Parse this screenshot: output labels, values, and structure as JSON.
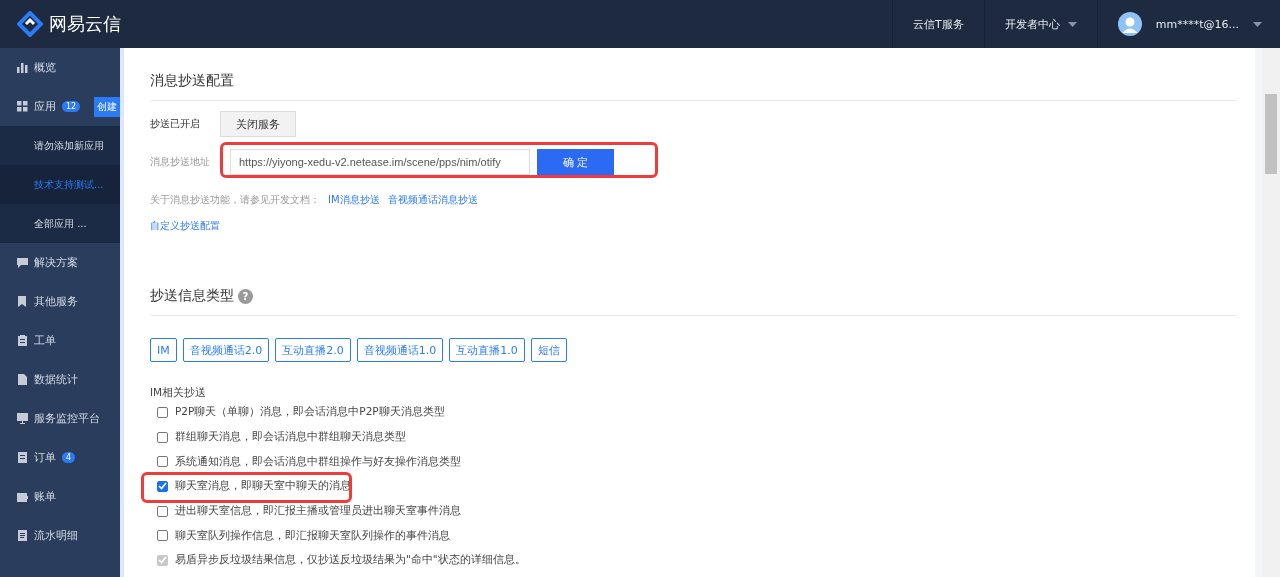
{
  "header": {
    "brand": "网易云信",
    "links": [
      {
        "label": "云信T服务",
        "dropdown": false
      },
      {
        "label": "开发者中心",
        "dropdown": true
      }
    ],
    "user": {
      "name": "mm****t@16..."
    }
  },
  "sidebar": {
    "items": [
      {
        "kind": "item",
        "label": "概览"
      },
      {
        "kind": "item",
        "label": "应用",
        "badge": "12",
        "action": "创建"
      },
      {
        "kind": "sub",
        "label": "请勿添加新应用",
        "selected": false
      },
      {
        "kind": "sub",
        "label": "技术支持测试...",
        "selected": true
      },
      {
        "kind": "sub",
        "label": "全部应用 ...",
        "selected": false
      },
      {
        "kind": "item",
        "label": "解决方案"
      },
      {
        "kind": "item",
        "label": "其他服务"
      },
      {
        "kind": "item",
        "label": "工单"
      },
      {
        "kind": "item",
        "label": "数据统计"
      },
      {
        "kind": "item",
        "label": "服务监控平台"
      },
      {
        "kind": "item",
        "label": "订单",
        "badge": "4"
      },
      {
        "kind": "item",
        "label": "账单"
      },
      {
        "kind": "item",
        "label": "流水明细"
      }
    ]
  },
  "config": {
    "title": "消息抄送配置",
    "status_label": "抄送已开启",
    "close_button": "关闭服务",
    "address_label": "消息抄送地址",
    "address_value": "https://yiyong-xedu-v2.netease.im/scene/pps/nim/otify",
    "confirm_button": "确 定",
    "highlighted": true,
    "doc_note": "关于消息抄送功能，请参见开发文档：",
    "doc_links": [
      "IM消息抄送",
      "音视频通话消息抄送"
    ],
    "custom_link": "自定义抄送配置"
  },
  "types": {
    "title": "抄送信息类型",
    "help": "?",
    "tags": [
      "IM",
      "音视频通话2.0",
      "互动直播2.0",
      "音视频通话1.0",
      "互动直播1.0",
      "短信"
    ],
    "group_title": "IM相关抄送",
    "options": [
      {
        "label": "P2P聊天（单聊）消息，即会话消息中P2P聊天消息类型",
        "checked": false,
        "disabled": false,
        "highlighted": false
      },
      {
        "label": "群组聊天消息，即会话消息中群组聊天消息类型",
        "checked": false,
        "disabled": false,
        "highlighted": false
      },
      {
        "label": "系统通知消息，即会话消息中群组操作与好友操作消息类型",
        "checked": false,
        "disabled": false,
        "highlighted": false
      },
      {
        "label": "聊天室消息，即聊天室中聊天的消息",
        "checked": true,
        "disabled": false,
        "highlighted": true
      },
      {
        "label": "进出聊天室信息，即汇报主播或管理员进出聊天室事件消息",
        "checked": false,
        "disabled": false,
        "highlighted": false
      },
      {
        "label": "聊天室队列操作信息，即汇报聊天室队列操作的事件消息",
        "checked": false,
        "disabled": false,
        "highlighted": false
      },
      {
        "label": "易盾异步反垃圾结果信息，仅抄送反垃圾结果为\"命中\"状态的详细信息。",
        "checked": true,
        "disabled": true,
        "highlighted": false
      }
    ]
  }
}
